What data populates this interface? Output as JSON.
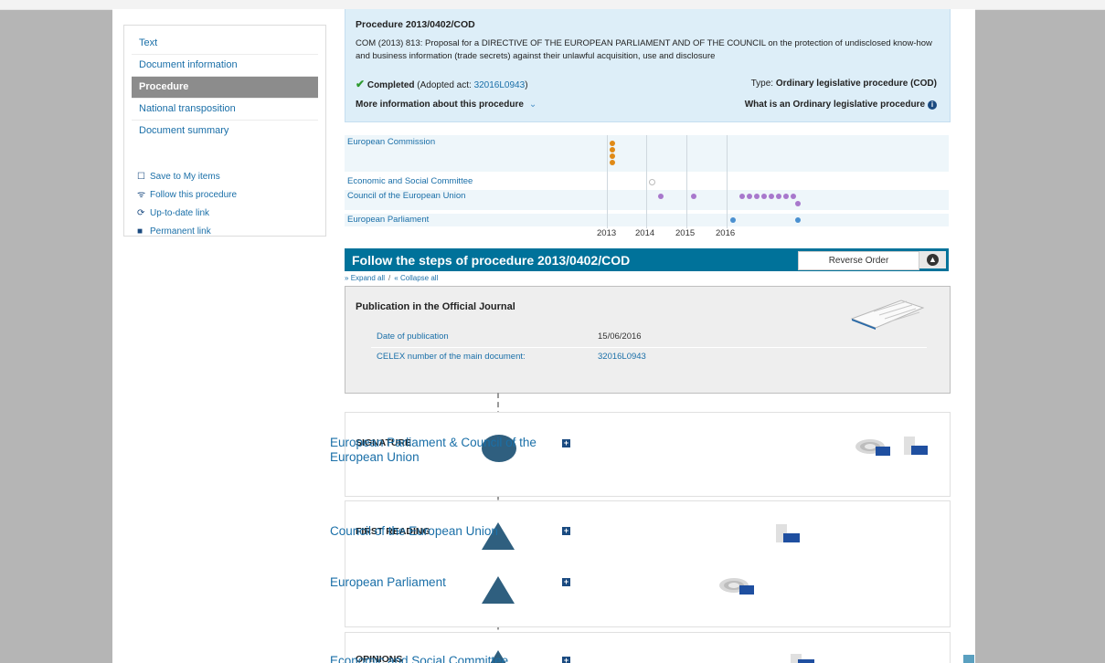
{
  "sidebar": {
    "nav": [
      "Text",
      "Document information",
      "Procedure",
      "National transposition",
      "Document summary"
    ],
    "active": "Procedure",
    "actions": [
      {
        "label": "Save to My items",
        "icon": "bookmark-outline-icon"
      },
      {
        "label": "Follow this procedure",
        "icon": "rss-icon"
      },
      {
        "label": "Up-to-date link",
        "icon": "refresh-icon"
      },
      {
        "label": "Permanent link",
        "icon": "bookmark-icon"
      }
    ]
  },
  "header": {
    "title": "Procedure 2013/0402/COD",
    "description": "COM (2013) 813: Proposal for a DIRECTIVE OF THE EUROPEAN PARLIAMENT AND OF THE COUNCIL on the protection of undisclosed know-how and business information (trade secrets) against their unlawful acquisition, use and disclosure",
    "status_label": "Completed",
    "adopted_prefix": "(Adopted act: ",
    "adopted_act": "32016L0943",
    "adopted_suffix": ")",
    "type_prefix": "Type: ",
    "type_value": "Ordinary legislative procedure (COD)",
    "more_info": "More information about this procedure",
    "what_is": "What is an Ordinary legislative procedure"
  },
  "timeline": {
    "rows": [
      "European Commission",
      "Economic and Social Committee",
      "Council of the European Union",
      "European Parliament"
    ],
    "years": [
      "2013",
      "2014",
      "2015",
      "2016"
    ],
    "colors": {
      "commission": "#e08a16",
      "esc": "#cccccc",
      "council": "#a878cc",
      "parliament": "#4a90d0"
    }
  },
  "steps": {
    "title": "Follow the steps of procedure 2013/0402/COD",
    "reverse": "Reverse Order",
    "expand_all": "Expand all",
    "collapse_all": "Collapse all",
    "expand_marker": "»",
    "collapse_marker": "«",
    "expand_separator": "/"
  },
  "publication": {
    "title": "Publication in the Official Journal",
    "rows": [
      {
        "key": "Date of publication",
        "value": "15/06/2016"
      },
      {
        "key": "CELEX number of the main document:",
        "value": "32016L0943"
      }
    ]
  },
  "stages": [
    {
      "name": "SIGNATURE",
      "entities": [
        "European Parliament & Council of the European Union"
      ]
    },
    {
      "name": "FIRST READING",
      "entities": [
        "Council of the European Union",
        "European Parliament"
      ]
    },
    {
      "name": "OPINIONS",
      "entities": [
        "Economic and Social Committee"
      ]
    }
  ]
}
